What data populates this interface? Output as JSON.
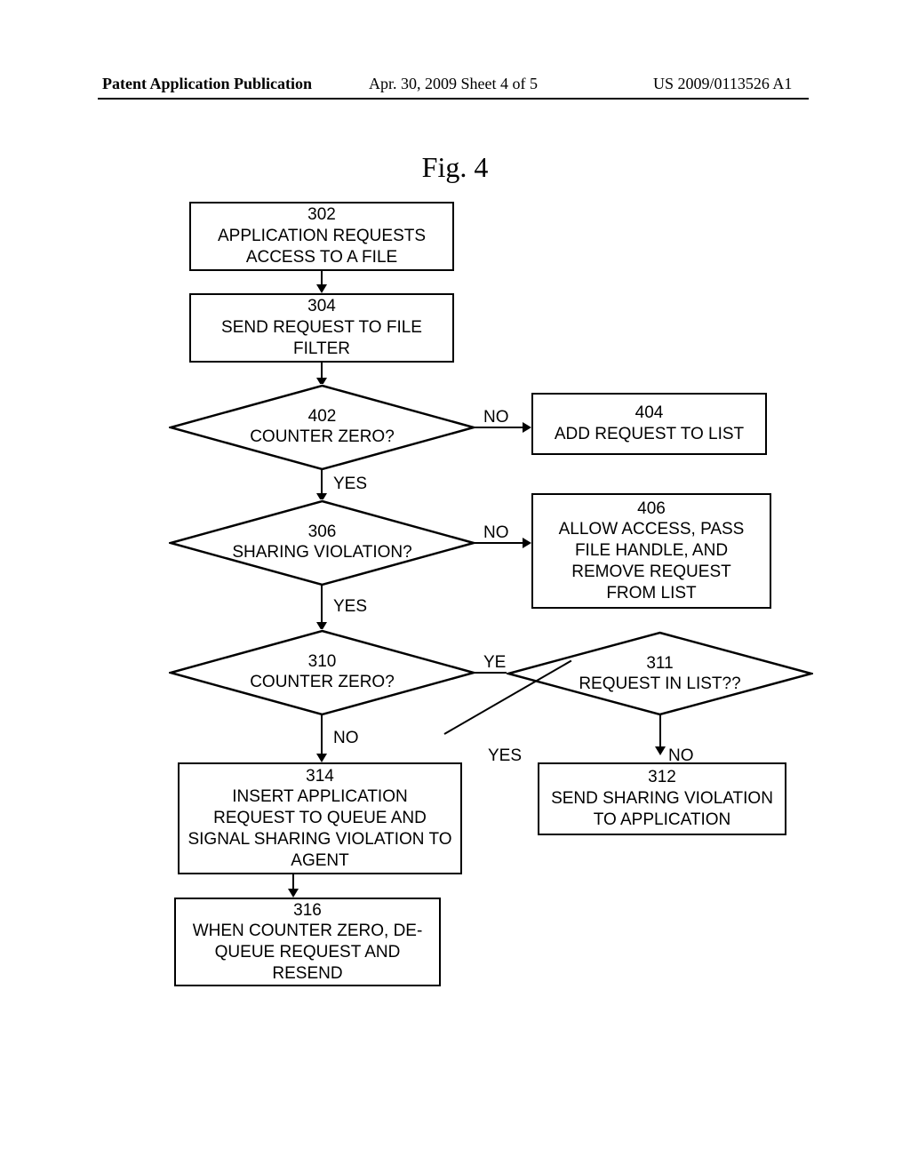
{
  "header": {
    "left": "Patent Application Publication",
    "center": "Apr. 30, 2009  Sheet 4 of 5",
    "right": "US 2009/0113526 A1"
  },
  "figure_title": "Fig. 4",
  "nodes": {
    "b302": {
      "num": "302",
      "text": "APPLICATION REQUESTS\nACCESS TO A FILE"
    },
    "b304": {
      "num": "304",
      "text": "SEND REQUEST TO FILE\nFILTER"
    },
    "d402": {
      "num": "402",
      "text": "COUNTER ZERO?"
    },
    "b404": {
      "num": "404",
      "text": "ADD REQUEST TO LIST"
    },
    "d306": {
      "num": "306",
      "text": "SHARING VIOLATION?"
    },
    "b406": {
      "num": "406",
      "text": "ALLOW ACCESS, PASS\nFILE HANDLE, AND\nREMOVE REQUEST\nFROM LIST"
    },
    "d310": {
      "num": "310",
      "text": "COUNTER ZERO?"
    },
    "d311": {
      "num": "311",
      "text": "REQUEST IN LIST??"
    },
    "b314": {
      "num": "314",
      "text": "INSERT APPLICATION\nREQUEST TO QUEUE AND\nSIGNAL SHARING VIOLATION TO\nAGENT"
    },
    "b312": {
      "num": "312",
      "text": "SEND SHARING VIOLATION\nTO APPLICATION"
    },
    "b316": {
      "num": "316",
      "text": "WHEN COUNTER ZERO, DE-\nQUEUE REQUEST AND\nRESEND"
    }
  },
  "labels": {
    "yes": "YES",
    "no": "NO"
  },
  "chart_data": {
    "type": "flowchart",
    "title": "Fig. 4",
    "nodes": [
      {
        "id": "302",
        "type": "process",
        "text": "APPLICATION REQUESTS ACCESS TO A FILE"
      },
      {
        "id": "304",
        "type": "process",
        "text": "SEND REQUEST TO FILE FILTER"
      },
      {
        "id": "402",
        "type": "decision",
        "text": "COUNTER ZERO?"
      },
      {
        "id": "404",
        "type": "process",
        "text": "ADD REQUEST TO LIST"
      },
      {
        "id": "306",
        "type": "decision",
        "text": "SHARING VIOLATION?"
      },
      {
        "id": "406",
        "type": "process",
        "text": "ALLOW ACCESS, PASS FILE HANDLE, AND REMOVE REQUEST FROM LIST"
      },
      {
        "id": "310",
        "type": "decision",
        "text": "COUNTER ZERO?"
      },
      {
        "id": "311",
        "type": "decision",
        "text": "REQUEST IN LIST??"
      },
      {
        "id": "314",
        "type": "process",
        "text": "INSERT APPLICATION REQUEST TO QUEUE AND SIGNAL SHARING VIOLATION TO AGENT"
      },
      {
        "id": "312",
        "type": "process",
        "text": "SEND SHARING VIOLATION TO APPLICATION"
      },
      {
        "id": "316",
        "type": "process",
        "text": "WHEN COUNTER ZERO, DE-QUEUE REQUEST AND RESEND"
      }
    ],
    "edges": [
      {
        "from": "302",
        "to": "304"
      },
      {
        "from": "304",
        "to": "402"
      },
      {
        "from": "402",
        "to": "404",
        "label": "NO"
      },
      {
        "from": "402",
        "to": "306",
        "label": "YES"
      },
      {
        "from": "306",
        "to": "406",
        "label": "NO"
      },
      {
        "from": "306",
        "to": "310",
        "label": "YES"
      },
      {
        "from": "310",
        "to": "311",
        "label": "YES"
      },
      {
        "from": "310",
        "to": "314",
        "label": "NO"
      },
      {
        "from": "311",
        "to": "312",
        "label": "NO"
      },
      {
        "from": "311",
        "to": "314",
        "label": "YES"
      },
      {
        "from": "314",
        "to": "316"
      }
    ]
  }
}
